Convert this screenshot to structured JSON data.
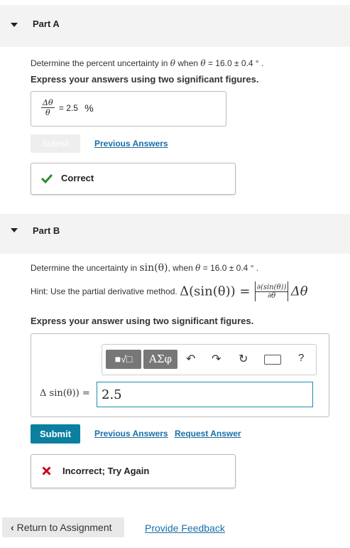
{
  "part_a": {
    "title": "Part A",
    "question_prefix": "Determine the percent uncertainty in ",
    "theta": "θ",
    "question_mid": " when ",
    "question_value": " = 16.0 ± 0.4 ° .",
    "instruction": "Express your answers using two significant figures.",
    "answer_numerator": "Δθ",
    "answer_denominator": "θ",
    "answer_equals": "= 2.5",
    "answer_unit": "%",
    "submit_label": "Submit",
    "previous_answers_label": "Previous Answers",
    "feedback_label": "Correct"
  },
  "part_b": {
    "title": "Part B",
    "question_prefix": "Determine the uncertainty in ",
    "sin_theta": "sin(θ)",
    "question_mid": ", when ",
    "theta": "θ",
    "question_value": " = 16.0 ± 0.4 ° .",
    "hint_prefix": "Hint: Use the partial derivative method. ",
    "hint_lhs": "Δ(sin(θ)) =",
    "hint_numerator": "∂(sin(θ))",
    "hint_denominator": "∂θ",
    "hint_rhs": "Δθ",
    "instruction": "Express your answer using two significant figures.",
    "toolbar_templates_label": "■√□",
    "toolbar_greek_label": "ΑΣφ",
    "toolbar_help_label": "?",
    "input_label": "Δ sin(θ)) =",
    "input_value": "2.5",
    "submit_label": "Submit",
    "previous_answers_label": "Previous Answers",
    "request_answer_label": "Request Answer",
    "feedback_label": "Incorrect; Try Again"
  },
  "footer": {
    "return_label": "Return to Assignment",
    "feedback_link": "Provide Feedback"
  },
  "colors": {
    "correct": "#2e8b2e",
    "incorrect": "#d0021b",
    "submit": "#0b7fa0",
    "link": "#1a6fa8"
  }
}
